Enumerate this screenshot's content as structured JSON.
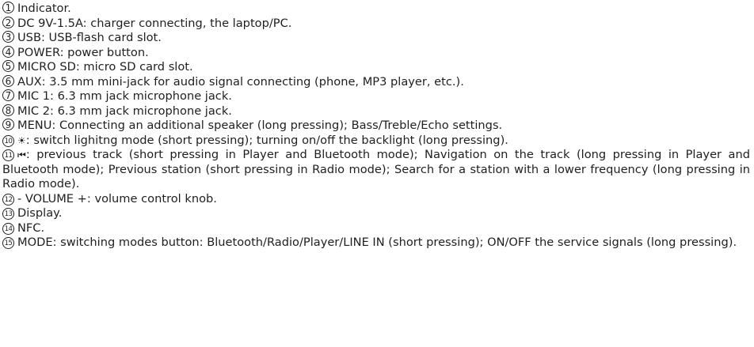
{
  "items": [
    {
      "num": "1",
      "text": "Indicator."
    },
    {
      "num": "2",
      "text": "DC 9V-1.5A: charger connecting, the laptop/PC."
    },
    {
      "num": "3",
      "text": "USB: USB-flash card slot."
    },
    {
      "num": "4",
      "text": "POWER: power button."
    },
    {
      "num": "5",
      "text": "MICRO SD: micro SD card slot."
    },
    {
      "num": "6",
      "text": "AUX: 3.5 mm mini-jack for audio signal connecting (phone, MP3 player, etc.)."
    },
    {
      "num": "7",
      "text": "MIC 1: 6.3 mm jack microphone jack."
    },
    {
      "num": "8",
      "text": "MIC 2: 6.3 mm jack microphone jack."
    },
    {
      "num": "9",
      "text": "MENU: Connecting an additional speaker (long pressing); Bass/Treble/Echo settings."
    },
    {
      "num": "10",
      "symbol": "☀",
      "text": ": switch lighitng mode (short pressing); turning on/off the backlight (long pressing)."
    },
    {
      "num": "11",
      "symbol": "⏮",
      "text": ": previous track (short pressing in Player and Bluetooth mode); Navigation on the track (long pressing in Player and Bluetooth mode); Previous station (short pressing in Radio mode); Search for a station with a lower frequency (long pressing in Radio mode)."
    },
    {
      "num": "12",
      "text": "- VOLUME +: volume control knob."
    },
    {
      "num": "13",
      "text": "Display."
    },
    {
      "num": "14",
      "text": "NFC."
    },
    {
      "num": "15",
      "text": "MODE: switching modes button: Bluetooth/Radio/Player/LINE IN (short pressing); ON/OFF the service signals (long pressing)."
    }
  ]
}
